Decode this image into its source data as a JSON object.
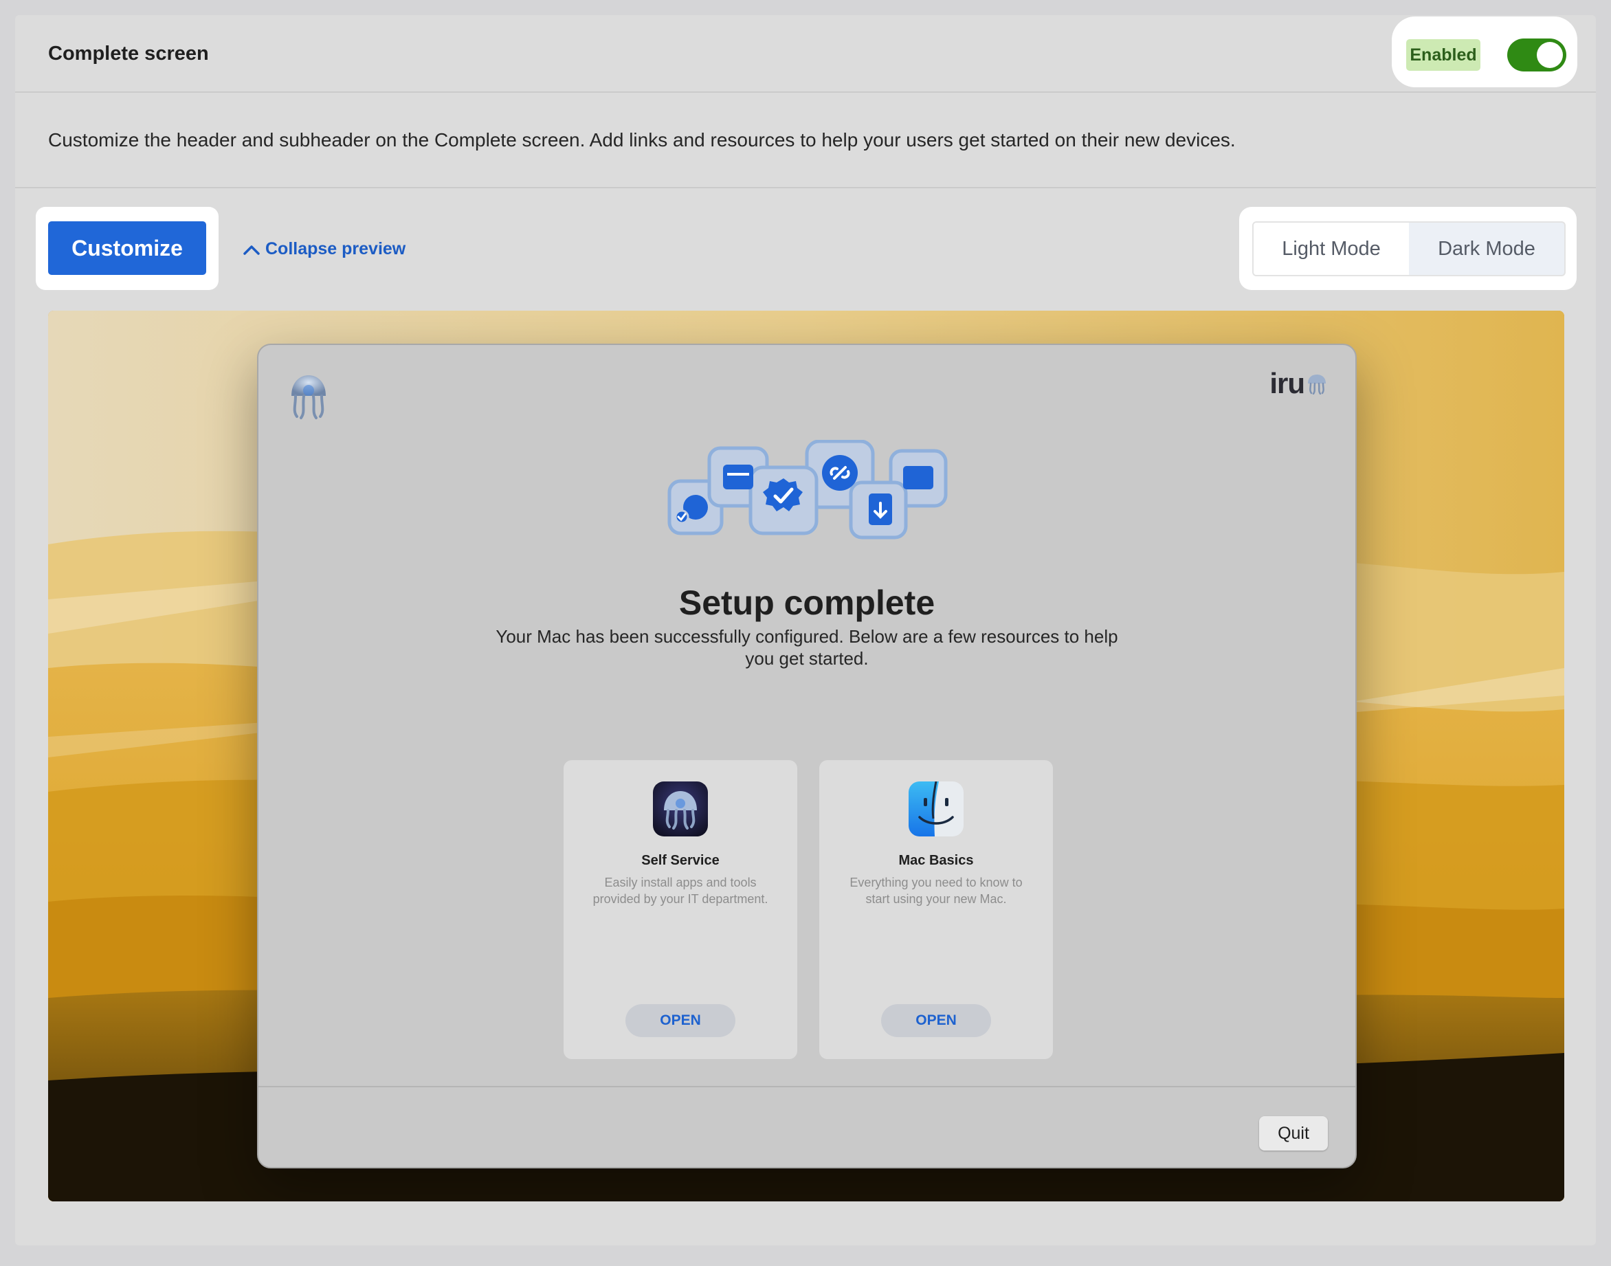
{
  "header": {
    "title": "Complete screen",
    "status_badge": "Enabled",
    "toggle_on": true
  },
  "description": "Customize the header and subheader on the Complete screen. Add links and resources to help your users get started on their new devices.",
  "toolbar": {
    "customize_label": "Customize",
    "collapse_label": "Collapse preview",
    "modes": [
      "Light Mode",
      "Dark Mode"
    ],
    "selected_mode": "Light Mode"
  },
  "preview": {
    "brand_text": "iru",
    "title": "Setup complete",
    "subtitle": "Your Mac has been successfully configured. Below are a few resources to help you get started.",
    "resources": [
      {
        "title": "Self Service",
        "description": "Easily install apps and tools provided by your IT department.",
        "action": "OPEN",
        "icon": "self-service-icon"
      },
      {
        "title": "Mac Basics",
        "description": "Everything you need to know to start using your new Mac.",
        "action": "OPEN",
        "icon": "finder-icon"
      }
    ],
    "quit_label": "Quit"
  },
  "colors": {
    "accent": "#2067d8",
    "toggle_on": "#2f8a14",
    "badge_bg": "#cdeab3",
    "link": "#1c5cc4"
  }
}
